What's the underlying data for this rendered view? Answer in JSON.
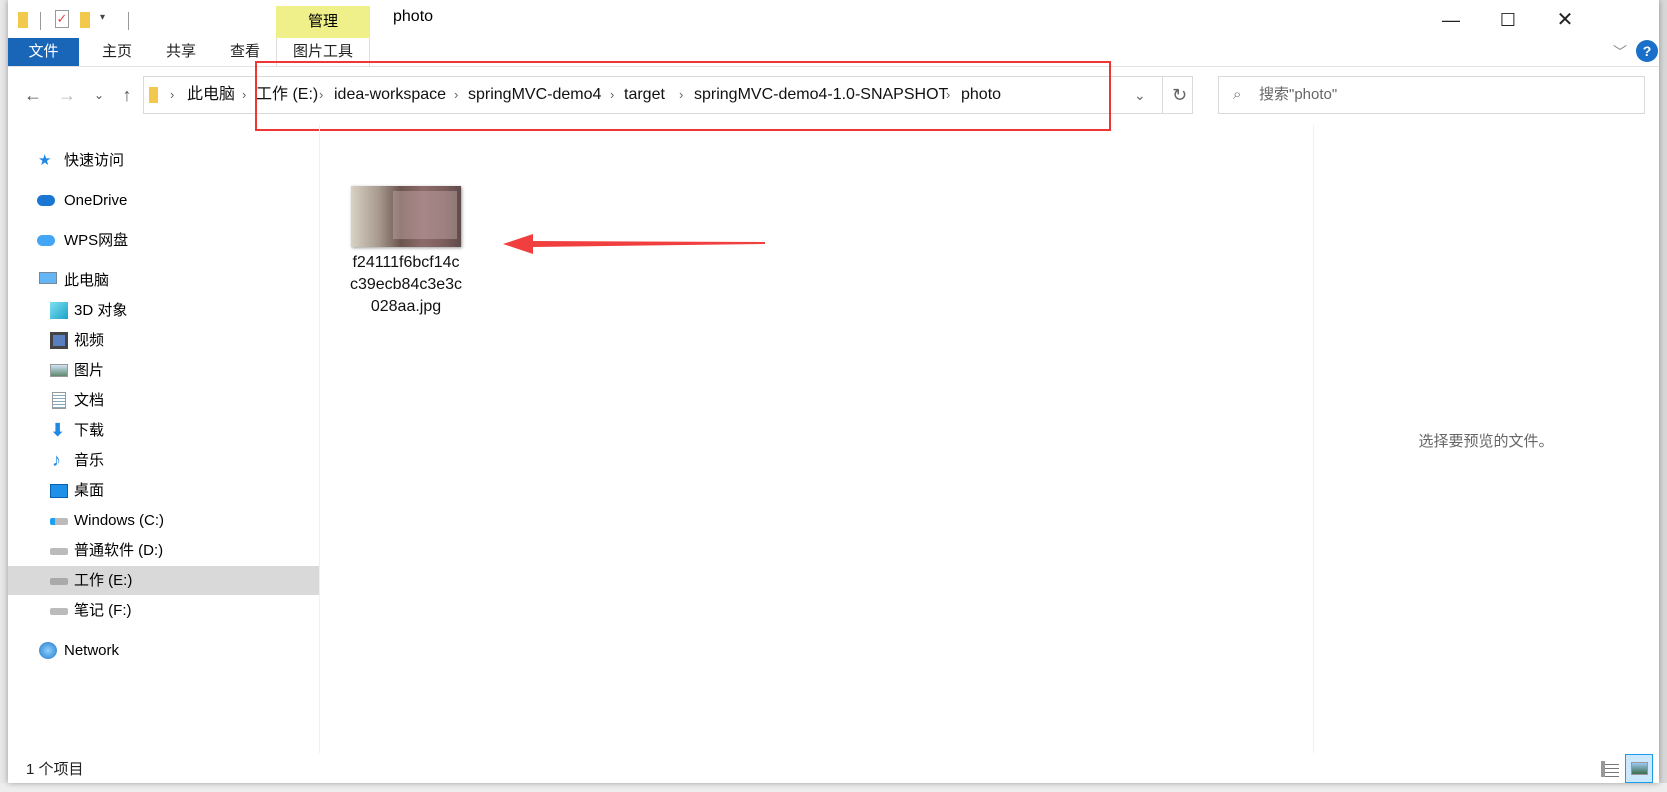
{
  "window": {
    "title": "photo",
    "context_tab_group": "管理",
    "minimize_icon": "minimize-icon",
    "maximize_icon": "maximize-icon",
    "close_icon": "close-icon"
  },
  "ribbon": {
    "tabs": [
      "文件",
      "主页",
      "共享",
      "查看"
    ],
    "context_tab": "图片工具"
  },
  "address": {
    "crumbs": [
      "此电脑",
      "工作 (E:)",
      "idea-workspace",
      "springMVC-demo4",
      "target",
      "springMVC-demo4-1.0-SNAPSHOT",
      "photo"
    ]
  },
  "search": {
    "placeholder": "搜索\"photo\""
  },
  "sidebar": {
    "items": [
      {
        "label": "快速访问",
        "icon": "star-icon"
      },
      {
        "label": "OneDrive",
        "icon": "cloud-icon"
      },
      {
        "label": "WPS网盘",
        "icon": "cloud-icon"
      },
      {
        "label": "此电脑",
        "icon": "computer-icon"
      },
      {
        "label": "3D 对象",
        "icon": "cube-icon"
      },
      {
        "label": "视频",
        "icon": "film-icon"
      },
      {
        "label": "图片",
        "icon": "picture-icon"
      },
      {
        "label": "文档",
        "icon": "document-icon"
      },
      {
        "label": "下载",
        "icon": "download-arrow-icon"
      },
      {
        "label": "音乐",
        "icon": "music-note-icon"
      },
      {
        "label": "桌面",
        "icon": "desktop-icon"
      },
      {
        "label": "Windows (C:)",
        "icon": "windows-drive-icon"
      },
      {
        "label": "普通软件 (D:)",
        "icon": "drive-icon"
      },
      {
        "label": "工作 (E:)",
        "icon": "drive-icon",
        "selected": true
      },
      {
        "label": "笔记 (F:)",
        "icon": "drive-icon"
      },
      {
        "label": "Network",
        "icon": "network-icon"
      }
    ]
  },
  "files": [
    {
      "name_lines": [
        "f24111f6bcf14c",
        "c39ecb84c3e3c",
        "028aa.jpg"
      ]
    }
  ],
  "preview": {
    "message": "选择要预览的文件。"
  },
  "status": {
    "count": "1 个项目"
  },
  "colors": {
    "file_tab": "#1966b9",
    "context_tab": "#f0f08a",
    "annotation": "#f03535",
    "selected": "#d9d9d9"
  }
}
